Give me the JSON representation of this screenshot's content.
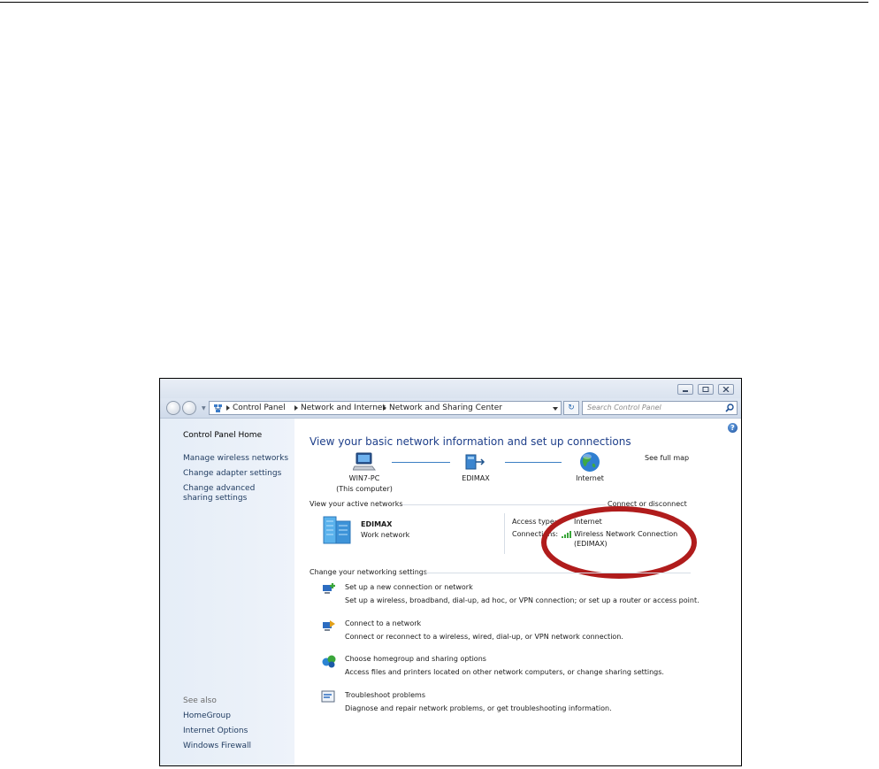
{
  "breadcrumb": {
    "items": [
      "Control Panel",
      "Network and Internet",
      "Network and Sharing Center"
    ]
  },
  "search": {
    "placeholder": "Search Control Panel"
  },
  "sidebar": {
    "home": "Control Panel Home",
    "links": [
      "Manage wireless networks",
      "Change adapter settings",
      "Change advanced sharing settings"
    ],
    "see_also_label": "See also",
    "see_also": [
      "HomeGroup",
      "Internet Options",
      "Windows Firewall"
    ]
  },
  "main": {
    "title": "View your basic network information and set up connections",
    "see_full_map": "See full map",
    "map": {
      "computer_name": "WIN7-PC",
      "computer_sub": "(This computer)",
      "network": "EDIMAX",
      "internet": "Internet"
    },
    "active_networks": {
      "heading": "View your active networks",
      "connect_link": "Connect or disconnect",
      "network_name": "EDIMAX",
      "network_type": "Work network",
      "access_type_label": "Access type:",
      "access_type_value": "Internet",
      "connections_label": "Connections:",
      "connection_name_line1": "Wireless Network Connection",
      "connection_name_line2": "(EDIMAX)"
    },
    "settings": {
      "heading": "Change your networking settings",
      "items": [
        {
          "title": "Set up a new connection or network",
          "desc": "Set up a wireless, broadband, dial-up, ad hoc, or VPN connection; or set up a router or access point."
        },
        {
          "title": "Connect to a network",
          "desc": "Connect or reconnect to a wireless, wired, dial-up, or VPN network connection."
        },
        {
          "title": "Choose homegroup and sharing options",
          "desc": "Access files and printers located on other network computers, or change sharing settings."
        },
        {
          "title": "Troubleshoot problems",
          "desc": "Diagnose and repair network problems, or get troubleshooting information."
        }
      ]
    }
  },
  "colors": {
    "link": "#2563b8",
    "title": "#1e3f8a",
    "annotation": "#b01c1c"
  },
  "icons": [
    "back-icon",
    "forward-icon",
    "network-folder-icon",
    "refresh-icon",
    "search-icon",
    "help-icon",
    "computer-icon",
    "network-icon",
    "globe-icon",
    "building-icon",
    "signal-icon",
    "new-connection-icon",
    "connect-icon",
    "homegroup-icon",
    "troubleshoot-icon"
  ]
}
